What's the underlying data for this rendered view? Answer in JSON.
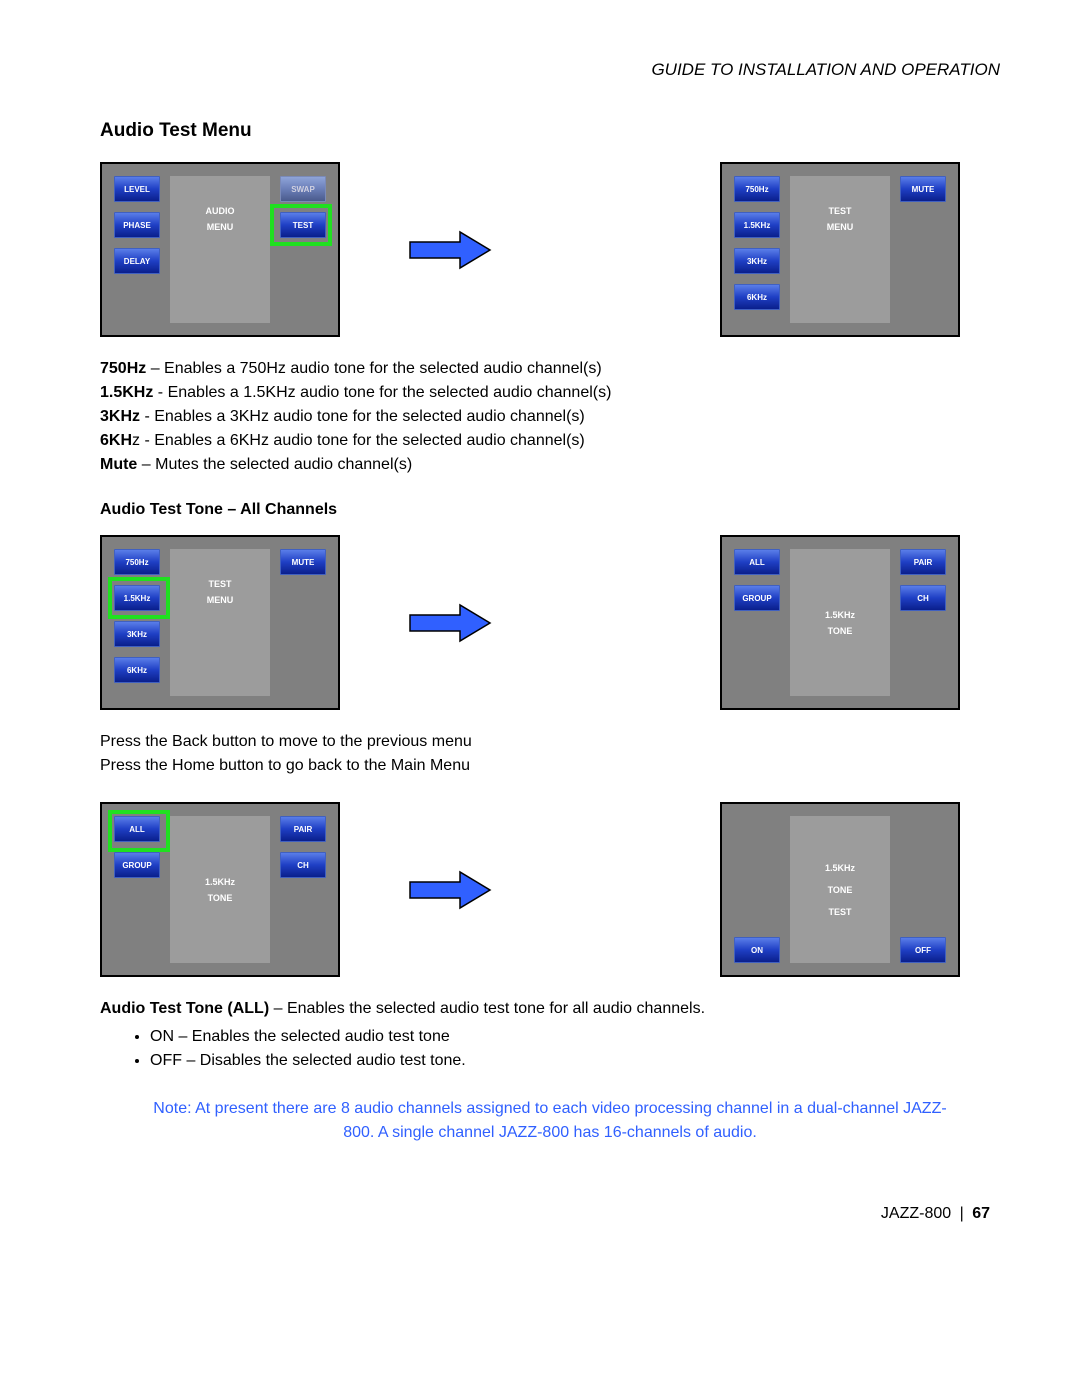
{
  "header": {
    "title": "GUIDE TO INSTALLATION AND OPERATION"
  },
  "section": {
    "title": "Audio Test Menu"
  },
  "screen1": {
    "center": {
      "line1": "AUDIO",
      "line2": "MENU"
    },
    "left": [
      "LEVEL",
      "PHASE",
      "DELAY"
    ],
    "right": [
      "SWAP",
      "TEST"
    ]
  },
  "screen2": {
    "center": {
      "line1": "TEST",
      "line2": "MENU"
    },
    "left": [
      "750Hz",
      "1.5KHz",
      "3KHz",
      "6KHz"
    ],
    "right": [
      "MUTE"
    ]
  },
  "defs": [
    {
      "term": "750Hz",
      "sep": " – ",
      "desc": "Enables a 750Hz audio tone for the selected audio channel(s)"
    },
    {
      "term": "1.5KHz",
      "sep": " - ",
      "desc": "Enables a 1.5KHz audio tone for the selected audio channel(s)"
    },
    {
      "term": "3KHz",
      "sep": " - ",
      "desc": "Enables a 3KHz audio tone for the selected audio channel(s)"
    },
    {
      "term": "6KH",
      "termTail": "z",
      "sep": " - ",
      "desc": "Enables a 6KHz audio tone for the selected audio channel(s)"
    },
    {
      "term": "Mute",
      "sep": " – ",
      "desc": "Mutes the selected audio channel(s)"
    }
  ],
  "subtitle": "Audio Test Tone – All Channels",
  "screen3": {
    "center": {
      "line1": "TEST",
      "line2": "MENU"
    },
    "left": [
      "750Hz",
      "1.5KHz",
      "3KHz",
      "6KHz"
    ],
    "right": [
      "MUTE"
    ]
  },
  "screen4": {
    "center": {
      "line1": "1.5KHz",
      "line2": "TONE"
    },
    "left": [
      "ALL",
      "GROUP"
    ],
    "right": [
      "PAIR",
      "CH"
    ]
  },
  "para2": {
    "line1": "Press the Back button to move to the previous menu",
    "line2": "Press the Home button to go back to the Main Menu"
  },
  "screen5": {
    "center": {
      "line1": "1.5KHz",
      "line2": "TONE"
    },
    "left": [
      "ALL",
      "GROUP"
    ],
    "right": [
      "PAIR",
      "CH"
    ]
  },
  "screen6": {
    "center": {
      "line1": "1.5KHz",
      "line2": "TONE",
      "line3": "TEST"
    },
    "left": [
      "ON"
    ],
    "right": [
      "OFF"
    ]
  },
  "block2": {
    "lead_term": "Audio Test Tone (ALL)",
    "lead_sep": " – ",
    "lead_desc": "Enables the selected audio test tone for all audio channels.",
    "bullets": [
      "ON – Enables the selected audio test tone",
      "OFF – Disables the selected audio test tone."
    ]
  },
  "note": "Note: At present there are 8 audio channels assigned to each video processing channel in a dual-channel JAZZ-800. A single channel JAZZ-800 has 16-channels of audio.",
  "footer": {
    "product": "JAZZ-800",
    "sep": "|",
    "page": "67"
  }
}
